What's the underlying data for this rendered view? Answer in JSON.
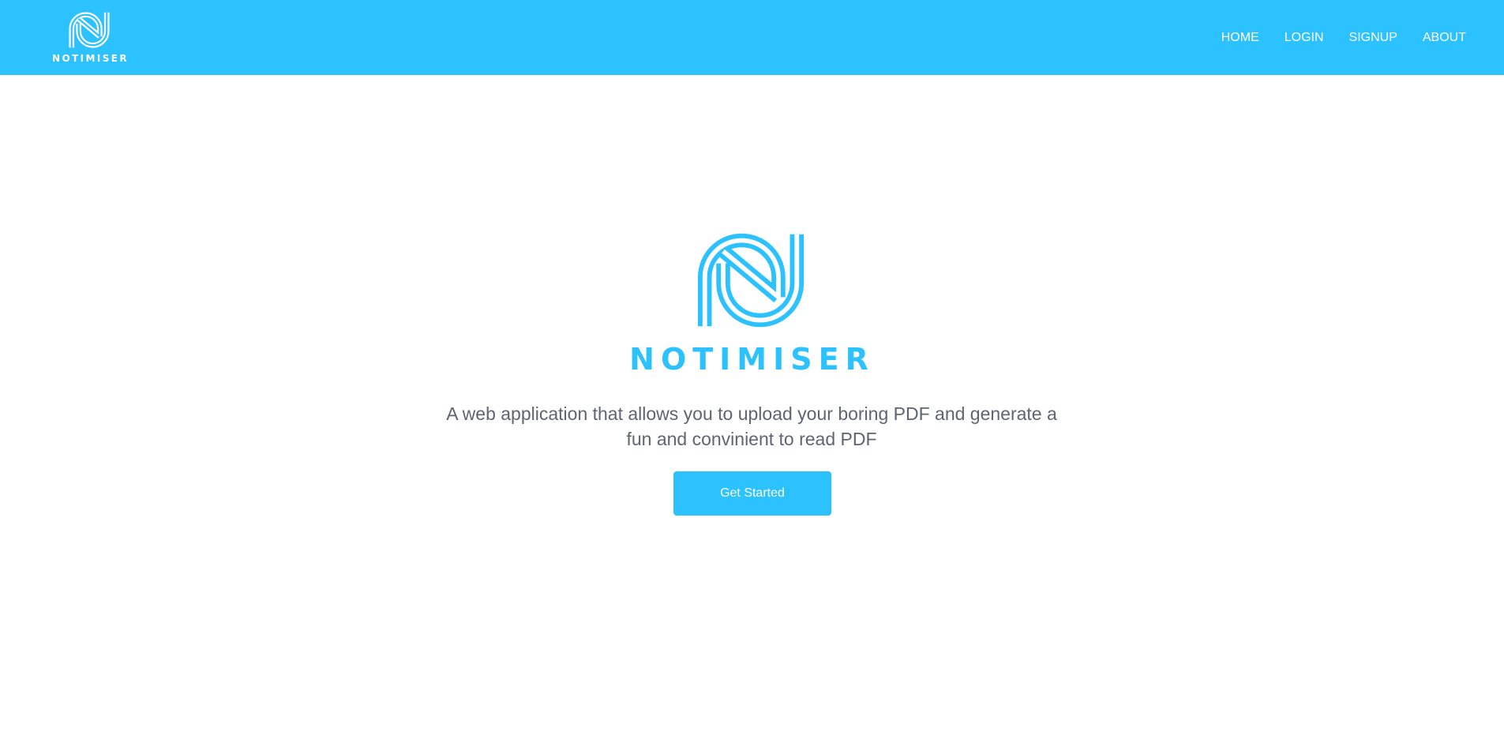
{
  "colors": {
    "brand": "#2cc1ff",
    "text_muted": "#5f6570",
    "on_brand": "#ffffff"
  },
  "header": {
    "logo_wordmark": "NOTIMISER",
    "logo_icon": "notimiser-logo-icon",
    "nav": [
      {
        "label": "HOME"
      },
      {
        "label": "LOGIN"
      },
      {
        "label": "SIGNUP"
      },
      {
        "label": "ABOUT"
      }
    ]
  },
  "hero": {
    "logo_icon": "notimiser-logo-icon",
    "wordmark": "NOTIMISER",
    "tagline": "A web application that allows you to upload your boring PDF and generate a fun and convinient to read PDF",
    "cta_label": "Get Started"
  }
}
